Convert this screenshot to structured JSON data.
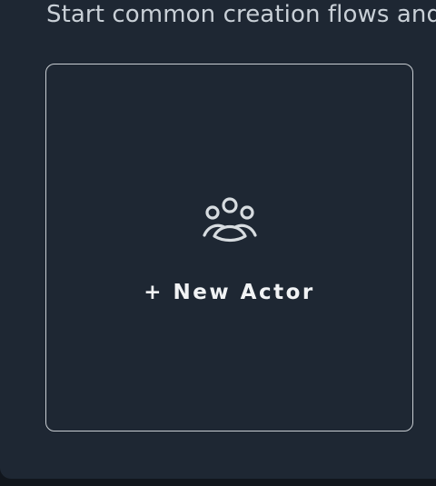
{
  "section": {
    "subtitle": "Start common creation flows and"
  },
  "actions": [
    {
      "label": "+ New Actor",
      "icon": "group-icon"
    }
  ],
  "colors": {
    "page_background": "#11161d",
    "panel_background": "#1e2733",
    "text_primary": "#f1f3f5",
    "text_secondary": "#c9d0d7",
    "card_border": "#c8cdd2"
  }
}
